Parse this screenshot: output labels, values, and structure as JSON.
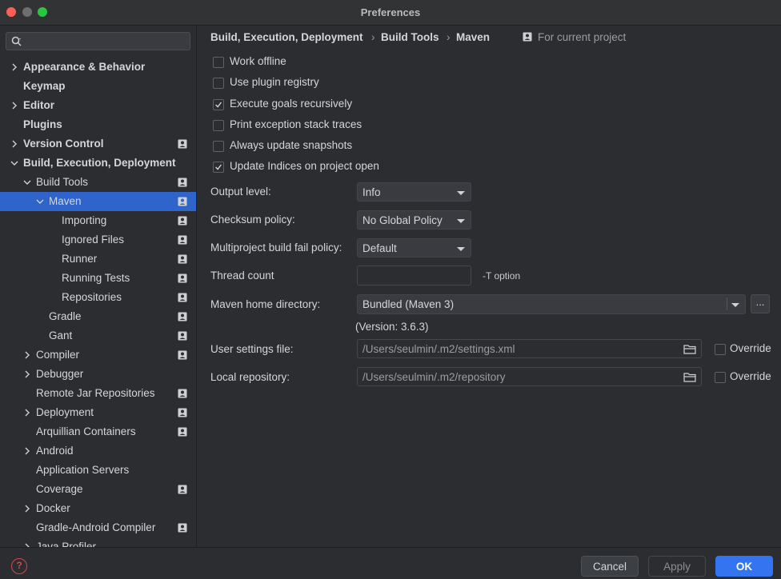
{
  "window": {
    "title": "Preferences"
  },
  "search": {
    "placeholder": ""
  },
  "sidebar": {
    "items": [
      {
        "label": "Appearance & Behavior",
        "level": 0,
        "bold": true,
        "chevron": "right",
        "project": false
      },
      {
        "label": "Keymap",
        "level": 0,
        "bold": true,
        "chevron": "none",
        "project": false
      },
      {
        "label": "Editor",
        "level": 0,
        "bold": true,
        "chevron": "right",
        "project": false
      },
      {
        "label": "Plugins",
        "level": 0,
        "bold": true,
        "chevron": "none",
        "project": false
      },
      {
        "label": "Version Control",
        "level": 0,
        "bold": true,
        "chevron": "right",
        "project": true
      },
      {
        "label": "Build, Execution, Deployment",
        "level": 0,
        "bold": true,
        "chevron": "down",
        "project": false
      },
      {
        "label": "Build Tools",
        "level": 1,
        "bold": false,
        "chevron": "down",
        "project": true
      },
      {
        "label": "Maven",
        "level": 2,
        "bold": false,
        "chevron": "down",
        "project": true,
        "selected": true
      },
      {
        "label": "Importing",
        "level": 3,
        "bold": false,
        "chevron": "none",
        "project": true
      },
      {
        "label": "Ignored Files",
        "level": 3,
        "bold": false,
        "chevron": "none",
        "project": true
      },
      {
        "label": "Runner",
        "level": 3,
        "bold": false,
        "chevron": "none",
        "project": true
      },
      {
        "label": "Running Tests",
        "level": 3,
        "bold": false,
        "chevron": "none",
        "project": true
      },
      {
        "label": "Repositories",
        "level": 3,
        "bold": false,
        "chevron": "none",
        "project": true
      },
      {
        "label": "Gradle",
        "level": 2,
        "bold": false,
        "chevron": "none",
        "project": true
      },
      {
        "label": "Gant",
        "level": 2,
        "bold": false,
        "chevron": "none",
        "project": true
      },
      {
        "label": "Compiler",
        "level": 1,
        "bold": false,
        "chevron": "right",
        "project": true
      },
      {
        "label": "Debugger",
        "level": 1,
        "bold": false,
        "chevron": "right",
        "project": false
      },
      {
        "label": "Remote Jar Repositories",
        "level": 1,
        "bold": false,
        "chevron": "none",
        "project": true
      },
      {
        "label": "Deployment",
        "level": 1,
        "bold": false,
        "chevron": "right",
        "project": true
      },
      {
        "label": "Arquillian Containers",
        "level": 1,
        "bold": false,
        "chevron": "none",
        "project": true
      },
      {
        "label": "Android",
        "level": 1,
        "bold": false,
        "chevron": "right",
        "project": false
      },
      {
        "label": "Application Servers",
        "level": 1,
        "bold": false,
        "chevron": "none",
        "project": false
      },
      {
        "label": "Coverage",
        "level": 1,
        "bold": false,
        "chevron": "none",
        "project": true
      },
      {
        "label": "Docker",
        "level": 1,
        "bold": false,
        "chevron": "right",
        "project": false
      },
      {
        "label": "Gradle-Android Compiler",
        "level": 1,
        "bold": false,
        "chevron": "none",
        "project": true
      },
      {
        "label": "Java Profiler",
        "level": 1,
        "bold": false,
        "chevron": "right",
        "project": false
      }
    ]
  },
  "breadcrumb": {
    "items": [
      "Build, Execution, Deployment",
      "Build Tools",
      "Maven"
    ],
    "separator": "›",
    "scope": "For current project"
  },
  "options": [
    {
      "label": "Work offline",
      "checked": false
    },
    {
      "label": "Use plugin registry",
      "checked": false
    },
    {
      "label": "Execute goals recursively",
      "checked": true
    },
    {
      "label": "Print exception stack traces",
      "checked": false
    },
    {
      "label": "Always update snapshots",
      "checked": false
    },
    {
      "label": "Update Indices on project open",
      "checked": true
    }
  ],
  "form": {
    "output_level": {
      "label": "Output level:",
      "value": "Info"
    },
    "checksum_policy": {
      "label": "Checksum policy:",
      "value": "No Global Policy"
    },
    "fail_policy": {
      "label": "Multiproject build fail policy:",
      "value": "Default"
    },
    "thread_count": {
      "label": "Thread count",
      "value": "",
      "hint": "-T option"
    },
    "maven_home": {
      "label": "Maven home directory:",
      "value": "Bundled (Maven 3)",
      "ellipsis": "...",
      "version": "(Version: 3.6.3)"
    },
    "user_settings": {
      "label": "User settings file:",
      "value": "/Users/seulmin/.m2/settings.xml",
      "override_label": "Override"
    },
    "local_repo": {
      "label": "Local repository:",
      "value": "/Users/seulmin/.m2/repository",
      "override_label": "Override"
    }
  },
  "footer": {
    "help": "?",
    "cancel": "Cancel",
    "apply": "Apply",
    "ok": "OK"
  },
  "colors": {
    "accent": "#3574f0",
    "selection": "#2f65ca",
    "background": "#2b2d30",
    "help": "#d04a4a"
  }
}
